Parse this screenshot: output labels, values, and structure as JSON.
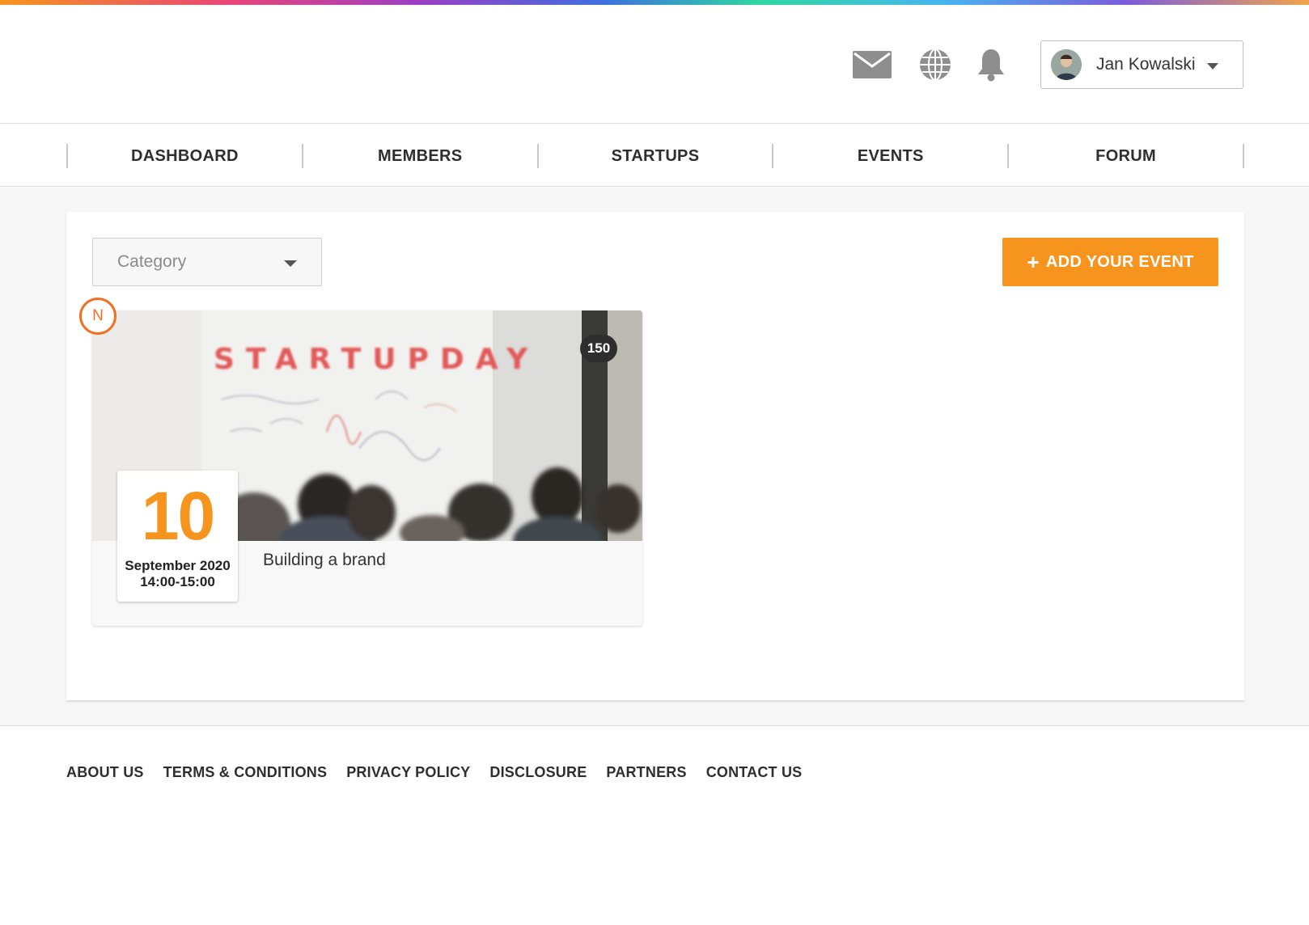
{
  "header": {
    "icons": [
      "mail-icon",
      "globe-icon",
      "bell-icon"
    ],
    "user": {
      "name": "Jan Kowalski"
    }
  },
  "nav": {
    "items": [
      {
        "label": "DASHBOARD"
      },
      {
        "label": "MEMBERS"
      },
      {
        "label": "STARTUPS"
      },
      {
        "label": "EVENTS"
      },
      {
        "label": "FORUM"
      }
    ]
  },
  "filters": {
    "category_placeholder": "Category"
  },
  "actions": {
    "add_event_label": "ADD YOUR EVENT"
  },
  "event": {
    "new_badge": "N",
    "attendees": "150",
    "image_text": "STARTUPDAY",
    "day": "10",
    "month_year": "September 2020",
    "time": "14:00-15:00",
    "title": "Building a brand"
  },
  "footer": {
    "links": [
      {
        "label": "ABOUT US"
      },
      {
        "label": "TERMS & CONDITIONS"
      },
      {
        "label": "PRIVACY POLICY"
      },
      {
        "label": "DISCLOSURE"
      },
      {
        "label": "PARTNERS"
      },
      {
        "label": "CONTACT US"
      }
    ]
  },
  "colors": {
    "accent": "#f7941d",
    "badge": "#f26f21",
    "text": "#2e2e2e",
    "background": "#f6f6f6"
  }
}
